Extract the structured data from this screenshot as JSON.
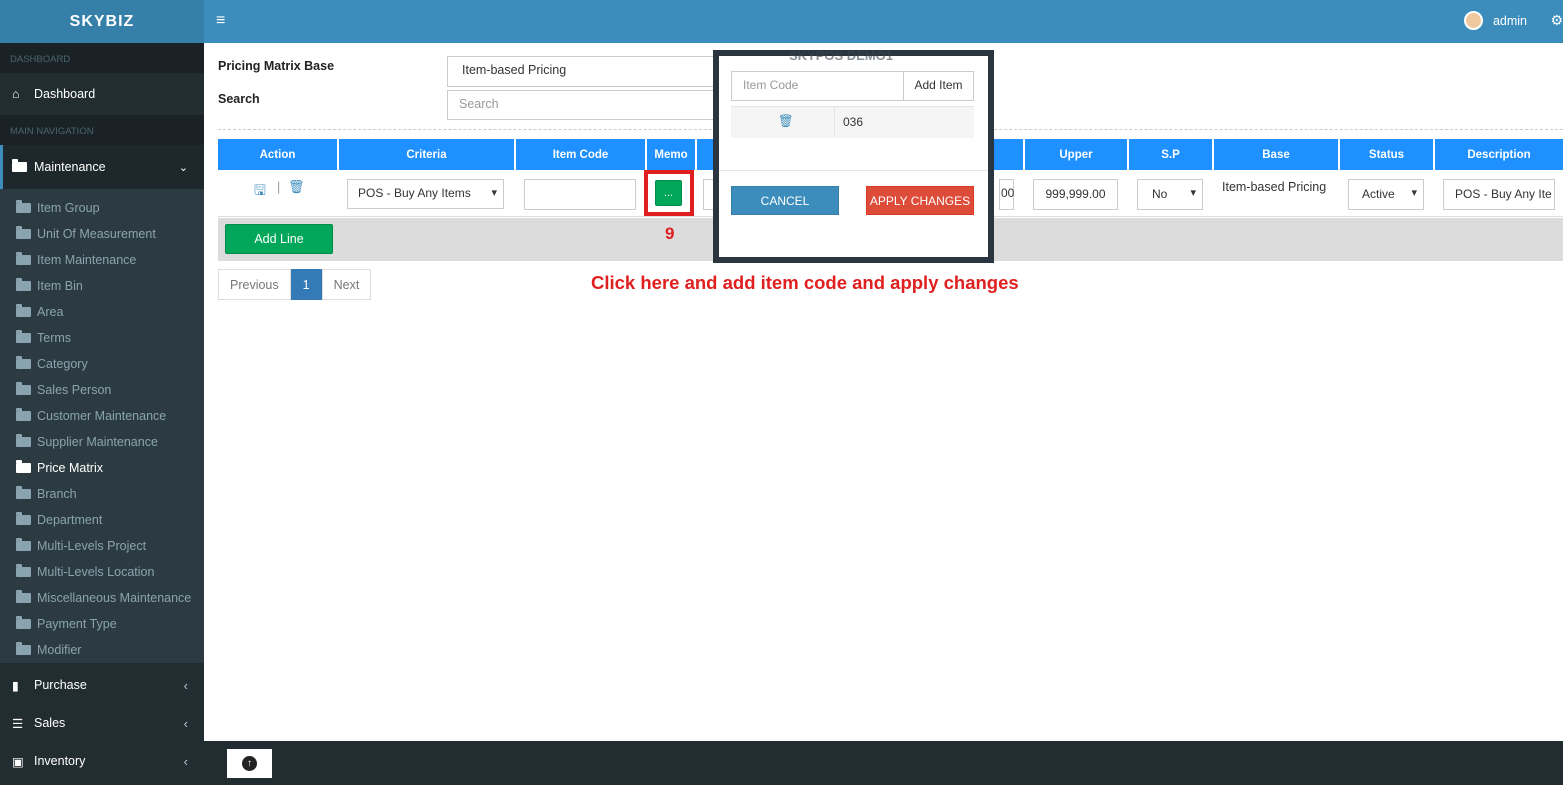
{
  "brand": "SKYBIZ",
  "sidebar": {
    "dashboard_header": "DASHBOARD",
    "dashboard": "Dashboard",
    "main_nav_header": "MAIN NAVIGATION",
    "maintenance": "Maintenance",
    "items": [
      "Item Group",
      "Unit Of Measurement",
      "Item Maintenance",
      "Item Bin",
      "Area",
      "Terms",
      "Category",
      "Sales Person",
      "Customer Maintenance",
      "Supplier Maintenance",
      "Price Matrix",
      "Branch",
      "Department",
      "Multi-Levels Project",
      "Multi-Levels Location",
      "Miscellaneous Maintenance",
      "Payment Type",
      "Modifier"
    ],
    "active_item": "Price Matrix",
    "purchase": "Purchase",
    "sales": "Sales",
    "inventory": "Inventory"
  },
  "header": {
    "user": "admin"
  },
  "form": {
    "pricing_base_label": "Pricing Matrix Base",
    "pricing_base_value": "Item-based Pricing",
    "search_label": "Search",
    "search_placeholder": "Search"
  },
  "table": {
    "headers": [
      "Action",
      "Criteria",
      "Item Code",
      "Memo",
      "",
      "",
      "",
      "Upper",
      "S.P",
      "Base",
      "Status",
      "Description"
    ],
    "row": {
      "criteria": "POS - Buy Any Items",
      "item_code": "",
      "memo_button": "...",
      "lower_partial": "00",
      "upper": "999,999.00",
      "sp": "No",
      "base": "Item-based Pricing",
      "status": "Active",
      "description": "POS - Buy Any Ite"
    },
    "add_line": "Add Line"
  },
  "pager": {
    "previous": "Previous",
    "page": "1",
    "next": "Next"
  },
  "annotation": {
    "step": "9",
    "instruction": "Click here and add item code and apply changes"
  },
  "modal": {
    "bg_title": "SKYPOS DEMO1",
    "item_code_placeholder": "Item Code",
    "add_item": "Add Item",
    "item_value": "036",
    "cancel": "CANCEL",
    "apply": "APPLY CHANGES"
  }
}
